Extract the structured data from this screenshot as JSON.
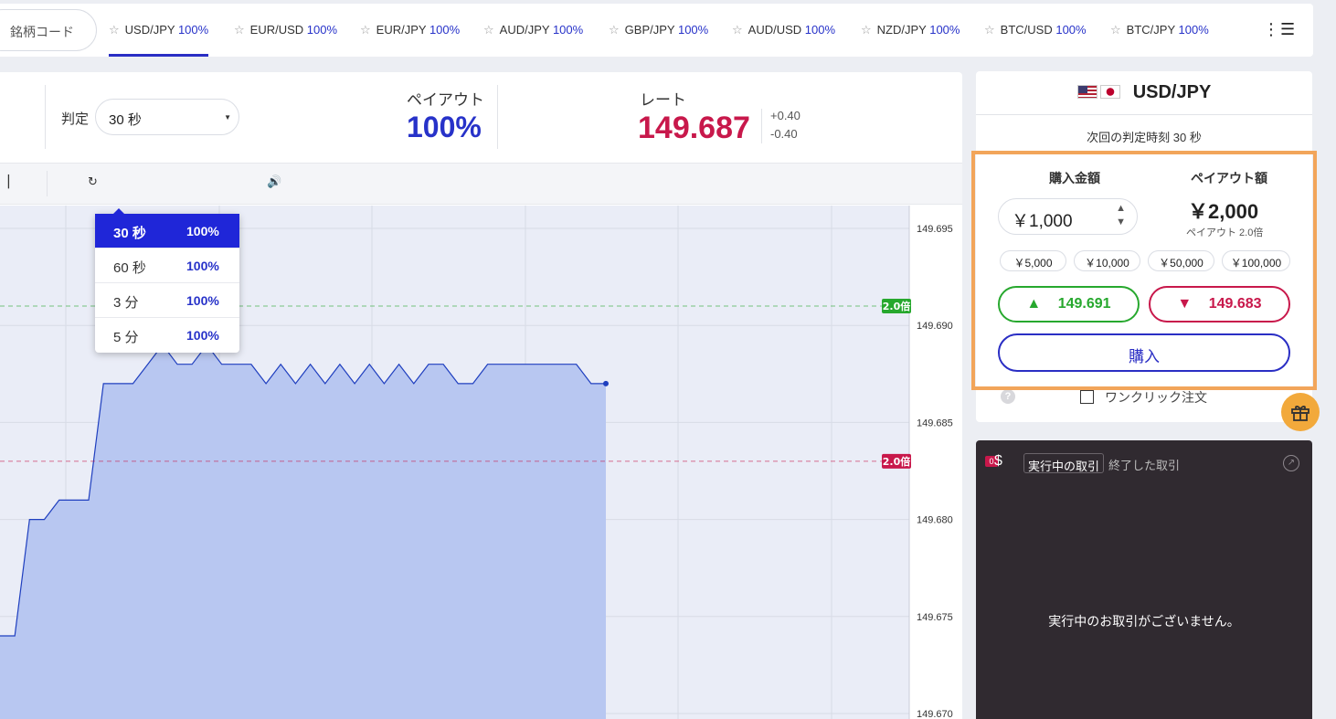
{
  "search": {
    "placeholder": "銘柄コード"
  },
  "tabs": [
    {
      "pair": "USD/JPY",
      "payout": "100%",
      "active": true
    },
    {
      "pair": "EUR/USD",
      "payout": "100%"
    },
    {
      "pair": "EUR/JPY",
      "payout": "100%"
    },
    {
      "pair": "AUD/JPY",
      "payout": "100%"
    },
    {
      "pair": "GBP/JPY",
      "payout": "100%"
    },
    {
      "pair": "AUD/USD",
      "payout": "100%"
    },
    {
      "pair": "NZD/JPY",
      "payout": "100%"
    },
    {
      "pair": "BTC/USD",
      "payout": "100%"
    },
    {
      "pair": "BTC/JPY",
      "payout": "100%"
    }
  ],
  "header": {
    "judge_label": "判定",
    "judge_selected": "30 秒",
    "payout_label": "ペイアウト",
    "payout_value": "100%",
    "rate_label": "レート",
    "rate_value": "149.687",
    "rate_plus": "+0.40",
    "rate_minus": "-0.40"
  },
  "dropdown": [
    {
      "time": "30 秒",
      "payout": "100%",
      "selected": true
    },
    {
      "time": "60 秒",
      "payout": "100%"
    },
    {
      "time": "3 分",
      "payout": "100%"
    },
    {
      "time": "5 分",
      "payout": "100%"
    }
  ],
  "chart_data": {
    "type": "area",
    "y_ticks": [
      "149.695",
      "149.690",
      "149.685",
      "149.680",
      "149.675",
      "149.670"
    ],
    "ylim": [
      149.67,
      149.695
    ],
    "upper_line": {
      "value": 149.691,
      "label": "2.0倍",
      "color": "#27a82e"
    },
    "lower_line": {
      "value": 149.683,
      "label": "2.0倍",
      "color": "#c8184b"
    },
    "series": [
      {
        "values": [
          149.674,
          149.674,
          149.68,
          149.68,
          149.681,
          149.681,
          149.681,
          149.687,
          149.687,
          149.687,
          149.688,
          149.689,
          149.688,
          149.688,
          149.689,
          149.688,
          149.688,
          149.688,
          149.687,
          149.688,
          149.687,
          149.688,
          149.687,
          149.688,
          149.687,
          149.688,
          149.687,
          149.688,
          149.687,
          149.688,
          149.688,
          149.687,
          149.687,
          149.688,
          149.688,
          149.688,
          149.688,
          149.688,
          149.688,
          149.688,
          149.687,
          149.687
        ]
      }
    ],
    "colors": {
      "line": "#1f3fbf",
      "fill": "#b8c7f1",
      "bg": "#eaedf7"
    },
    "grid": true
  },
  "order": {
    "pair": "USD/JPY",
    "next_judge": "次回の判定時刻 30 秒",
    "amount_label": "購入金額",
    "payout_label": "ペイアウト額",
    "amount": "￥1,000",
    "payout_amount": "￥2,000",
    "payout_mult": "ペイアウト 2.0倍",
    "chips": [
      "￥5,000",
      "￥10,000",
      "￥50,000",
      "￥100,000"
    ],
    "high_price": "149.691",
    "low_price": "149.683",
    "buy_label": "購入",
    "oneclick_label": "ワンクリック注文"
  },
  "positions": {
    "count": "0",
    "tab_running": "実行中の取引",
    "tab_done": "終了した取引",
    "empty": "実行中のお取引がございません。"
  }
}
